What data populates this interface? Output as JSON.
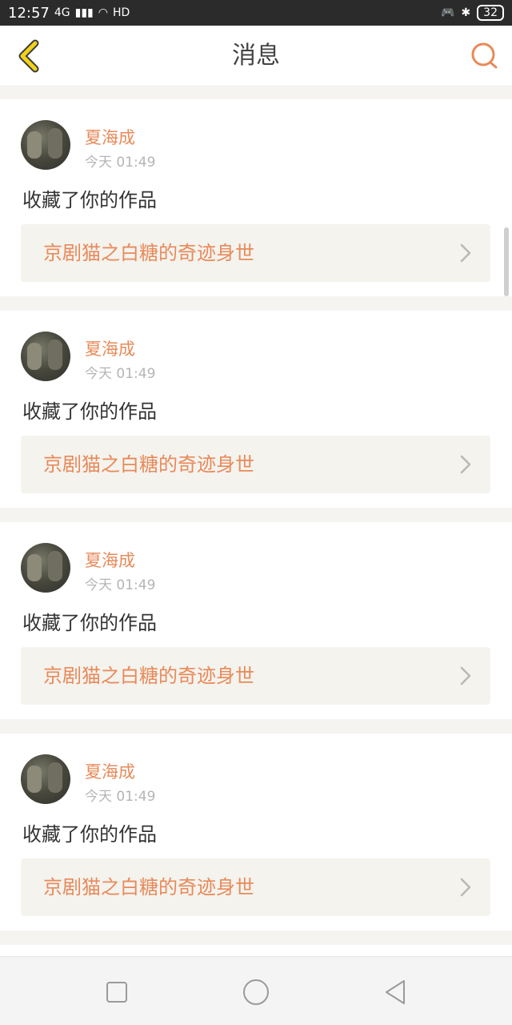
{
  "status_bar": {
    "time": "12:57",
    "network": "4G",
    "hd": "HD",
    "battery": "32"
  },
  "header": {
    "title": "消息",
    "back_icon": "chevron-left-icon",
    "search_icon": "search-icon"
  },
  "notifications": [
    {
      "user": "夏海成",
      "time": "今天 01:49",
      "message": "收藏了你的作品",
      "work_title": "京剧猫之白糖的奇迹身世"
    },
    {
      "user": "夏海成",
      "time": "今天 01:49",
      "message": "收藏了你的作品",
      "work_title": "京剧猫之白糖的奇迹身世"
    },
    {
      "user": "夏海成",
      "time": "今天 01:49",
      "message": "收藏了你的作品",
      "work_title": "京剧猫之白糖的奇迹身世"
    },
    {
      "user": "夏海成",
      "time": "今天 01:49",
      "message": "收藏了你的作品",
      "work_title": "京剧猫之白糖的奇迹身世"
    }
  ],
  "nav_bar": {
    "recent_icon": "square-icon",
    "home_icon": "circle-icon",
    "back_icon": "triangle-back-icon"
  },
  "colors": {
    "accent": "#e88a5a",
    "back_arrow": "#f2d21a"
  }
}
